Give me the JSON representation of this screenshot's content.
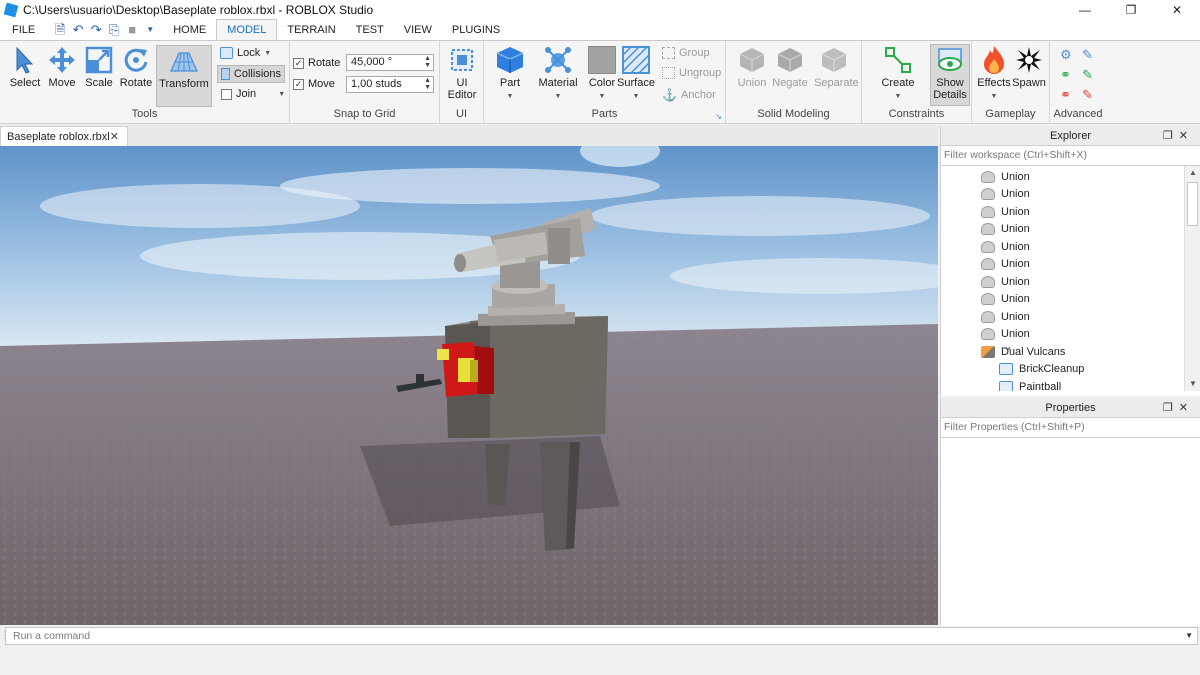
{
  "window": {
    "title": "C:\\Users\\usuario\\Desktop\\Baseplate roblox.rbxl - ROBLOX Studio"
  },
  "menu": {
    "file": "FILE",
    "tabs": [
      "HOME",
      "MODEL",
      "TERRAIN",
      "TEST",
      "VIEW",
      "PLUGINS"
    ],
    "active_tab": "MODEL"
  },
  "ribbon": {
    "tools": {
      "title": "Tools",
      "select": "Select",
      "move": "Move",
      "scale": "Scale",
      "rotate": "Rotate",
      "transform": "Transform",
      "lock": "Lock",
      "collisions": "Collisions",
      "join": "Join"
    },
    "snap": {
      "title": "Snap to Grid",
      "rotate_label": "Rotate",
      "rotate_value": "45,000 °",
      "move_label": "Move",
      "move_value": "1,00 studs"
    },
    "ui": {
      "title": "UI",
      "editor_line1": "UI",
      "editor_line2": "Editor"
    },
    "parts": {
      "title": "Parts",
      "part": "Part",
      "material": "Material",
      "color": "Color",
      "surface": "Surface",
      "group": "Group",
      "ungroup": "Ungroup",
      "anchor": "Anchor"
    },
    "solid": {
      "title": "Solid Modeling",
      "union": "Union",
      "negate": "Negate",
      "separate": "Separate"
    },
    "constraints": {
      "title": "Constraints",
      "create": "Create",
      "show_line1": "Show",
      "show_line2": "Details"
    },
    "gameplay": {
      "title": "Gameplay",
      "effects": "Effects",
      "spawn": "Spawn"
    },
    "advanced": {
      "title": "Advanced"
    }
  },
  "document": {
    "tab": "Baseplate roblox.rbxl"
  },
  "explorer": {
    "title": "Explorer",
    "filter_placeholder": "Filter workspace (Ctrl+Shift+X)",
    "items": [
      {
        "label": "Union",
        "icon": "union-icon"
      },
      {
        "label": "Union",
        "icon": "union-icon"
      },
      {
        "label": "Union",
        "icon": "union-icon"
      },
      {
        "label": "Union",
        "icon": "union-icon"
      },
      {
        "label": "Union",
        "icon": "union-icon"
      },
      {
        "label": "Union",
        "icon": "union-icon"
      },
      {
        "label": "Union",
        "icon": "union-icon"
      },
      {
        "label": "Union",
        "icon": "union-icon"
      },
      {
        "label": "Union",
        "icon": "union-icon"
      },
      {
        "label": "Union",
        "icon": "union-icon"
      },
      {
        "label": "Dual Vulcans",
        "icon": "tool-icon"
      },
      {
        "label": "BrickCleanup",
        "icon": "script-icon"
      },
      {
        "label": "Paintball",
        "icon": "script-icon"
      }
    ]
  },
  "properties": {
    "title": "Properties",
    "filter_placeholder": "Filter Properties (Ctrl+Shift+P)"
  },
  "command": {
    "placeholder": "Run a command"
  },
  "colors": {
    "accent": "#1a6fc0",
    "sky_top": "#5f93c9",
    "ground": "#7c7278",
    "part_blue": "#2f7fe0"
  }
}
